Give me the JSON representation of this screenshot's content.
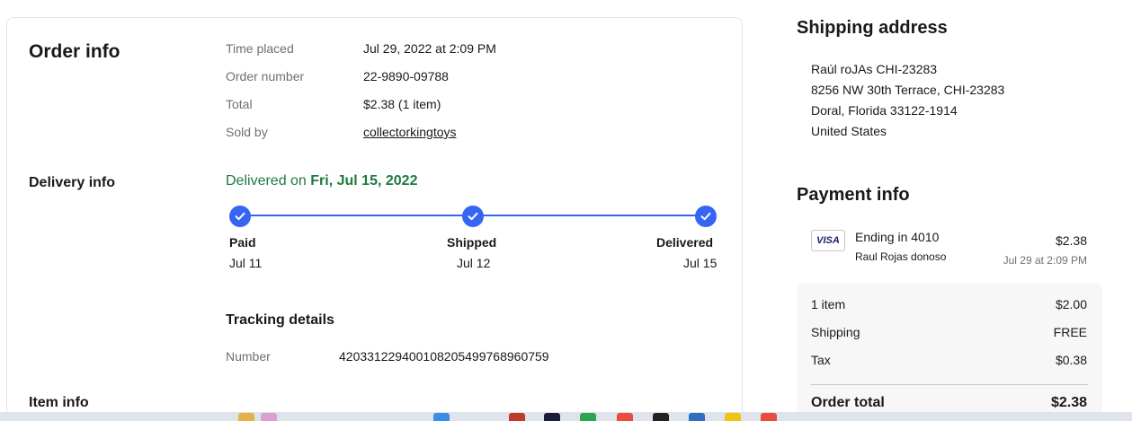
{
  "order_info": {
    "title": "Order info",
    "rows": [
      {
        "label": "Time placed",
        "value": "Jul 29, 2022 at 2:09 PM"
      },
      {
        "label": "Order number",
        "value": "22-9890-09788"
      },
      {
        "label": "Total",
        "value": "$2.38 (1 item)"
      },
      {
        "label": "Sold by",
        "value": "collectorkingtoys"
      }
    ]
  },
  "delivery_info": {
    "title": "Delivery info",
    "status_prefix": "Delivered on ",
    "status_date": "Fri, Jul 15, 2022",
    "steps": [
      {
        "label": "Paid",
        "date": "Jul 11"
      },
      {
        "label": "Shipped",
        "date": "Jul 12"
      },
      {
        "label": "Delivered",
        "date": "Jul 15"
      }
    ],
    "tracking_title": "Tracking details",
    "tracking_label": "Number",
    "tracking_number": "420331229400108205499768960759"
  },
  "item_info": {
    "title": "Item info"
  },
  "shipping_address": {
    "title": "Shipping address",
    "lines": [
      "Raúl roJAs CHI-23283",
      "8256 NW 30th Terrace, CHI-23283",
      "Doral, Florida 33122-1914",
      "United States"
    ]
  },
  "payment_info": {
    "title": "Payment info",
    "card_brand": "VISA",
    "card_ending": "Ending in 4010",
    "card_holder": "Raul Rojas donoso",
    "amount": "$2.38",
    "date": "Jul 29 at 2:09 PM"
  },
  "summary": {
    "rows": [
      {
        "label": "1 item",
        "value": "$2.00"
      },
      {
        "label": "Shipping",
        "value": "FREE"
      },
      {
        "label": "Tax",
        "value": "$0.38"
      }
    ],
    "total_label": "Order total",
    "total_value": "$2.38"
  },
  "colors": {
    "accent": "#3665f3",
    "delivered_green": "#1f7a3d",
    "muted_text": "#707070"
  }
}
